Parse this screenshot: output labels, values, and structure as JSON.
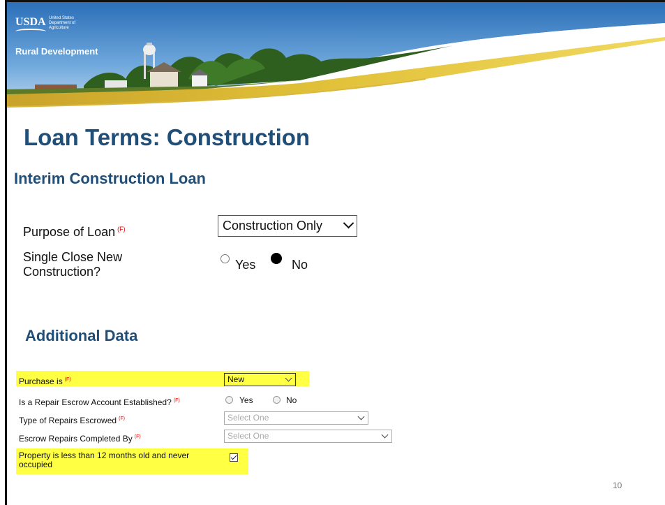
{
  "banner": {
    "logo_text": "USDA",
    "agency_lines": "United States Department of Agriculture",
    "org_name": "Rural Development"
  },
  "page_title": "Loan Terms:  Construction",
  "section_interim": {
    "heading": "Interim Construction Loan",
    "purpose_label": "Purpose of Loan",
    "purpose_flag": "(F)",
    "purpose_value": "Construction Only",
    "single_close_label": "Single Close New Construction?",
    "single_close_options": [
      "Yes",
      "No"
    ],
    "single_close_selected": "No"
  },
  "section_additional": {
    "heading": "Additional Data",
    "purchase_label": "Purchase is",
    "purchase_flag": "(F)",
    "purchase_value": "New",
    "repair_escrow_label": "Is a Repair Escrow Account Established?",
    "repair_escrow_flag": "(F)",
    "repair_escrow_options": [
      "Yes",
      "No"
    ],
    "repair_type_label": "Type of Repairs Escrowed",
    "repair_type_flag": "(F)",
    "repair_type_placeholder": "Select One",
    "repairs_completed_label": "Escrow Repairs Completed By",
    "repairs_completed_flag": "(F)",
    "repairs_completed_placeholder": "Select One",
    "property_label": "Property is less than 12 months old and never occupied",
    "property_checked": true
  },
  "page_number": "10",
  "colors": {
    "heading_blue": "#1f4e79",
    "highlight_yellow": "#ffff44",
    "flag_red": "#dd0000"
  }
}
